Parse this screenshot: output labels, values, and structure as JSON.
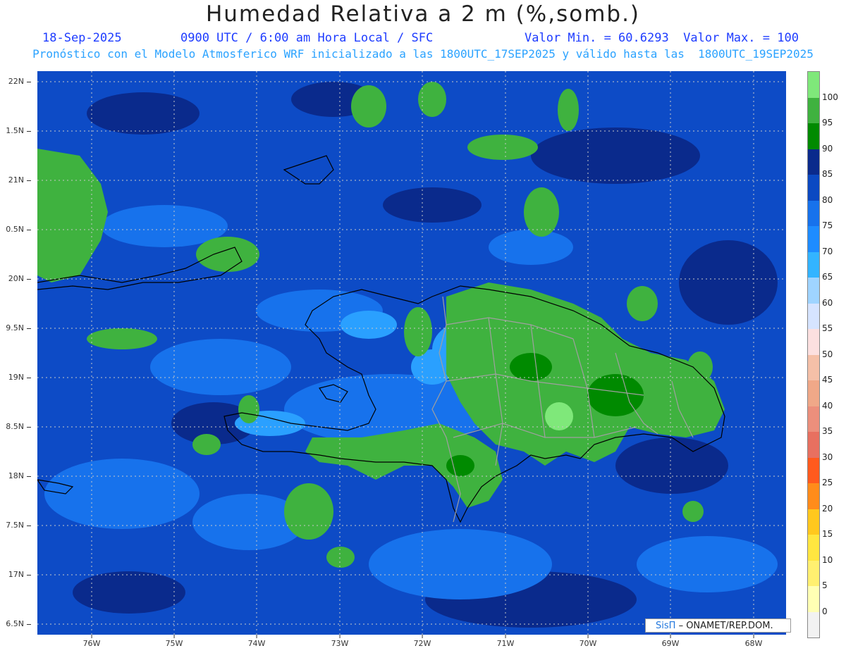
{
  "title": "Humedad Relativa a 2 m (%,somb.)",
  "date": "18-Sep-2025",
  "time_info": "0900 UTC / 6:00 am Hora Local / SFC",
  "stats": "Valor Min. = 60.6293  Valor Max. = 100",
  "forecast_info": "Pronóstico con el Modelo Atmosferico WRF inicializado a las 1800UTC_17SEP2025 y válido hasta las  1800UTC_19SEP2025",
  "lat_labels": [
    "22N",
    "1.5N",
    "21N",
    "0.5N",
    "20N",
    "9.5N",
    "19N",
    "8.5N",
    "18N",
    "7.5N",
    "17N",
    "6.5N"
  ],
  "lon_labels": [
    "76W",
    "75W",
    "74W",
    "73W",
    "72W",
    "71W",
    "70W",
    "69W",
    "68W"
  ],
  "colorbar": {
    "labels": [
      "100",
      "95",
      "90",
      "85",
      "80",
      "75",
      "70",
      "65",
      "60",
      "55",
      "50",
      "45",
      "40",
      "35",
      "30",
      "25",
      "20",
      "15",
      "10",
      "5",
      "0"
    ],
    "colors": [
      "#7fe87a",
      "#3fb23f",
      "#008a00",
      "#0a2a8c",
      "#0b49c2",
      "#1772ec",
      "#1e8cff",
      "#33b4ff",
      "#9fd4ff",
      "#d6e4ff",
      "#fce0e0",
      "#f5c0a8",
      "#f0a888",
      "#ec8f7c",
      "#e87060",
      "#ff5a1e",
      "#ff8c1a",
      "#ffc81e",
      "#ffe640",
      "#fff070",
      "#ffffb4",
      "#f2f2f2"
    ]
  },
  "credit": {
    "brand": "SisΠ",
    "text": "– ONAMET/REP.DOM."
  },
  "field_colors": {
    "base": "#0d4bc6",
    "dark": "#0a2a8c",
    "mid": "#1772ec",
    "light": "#2aa0ff",
    "green": "#3fb23f",
    "darkgreen": "#008a00",
    "lightgreen": "#7fe87a"
  }
}
